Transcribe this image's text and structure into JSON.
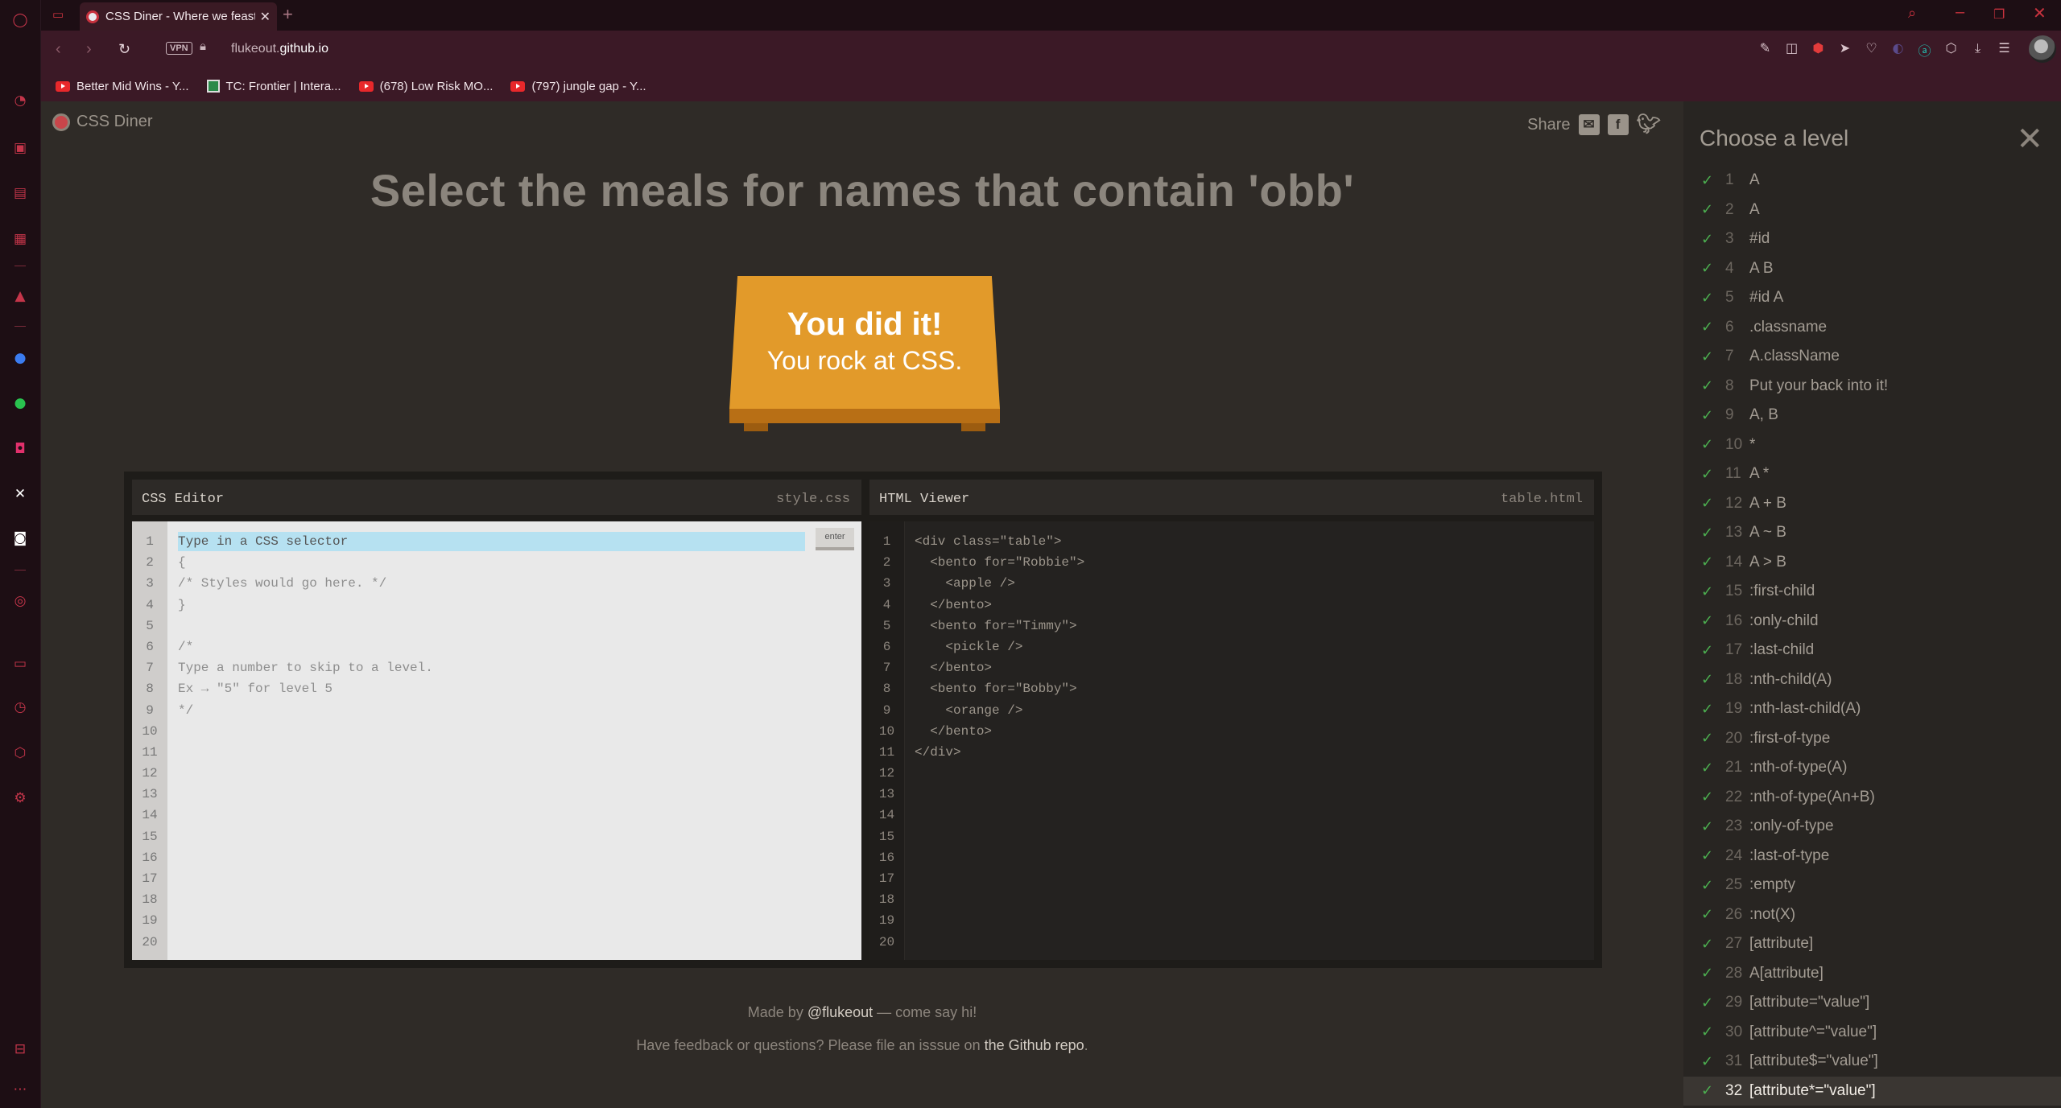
{
  "browser": {
    "tab_title": "CSS Diner - Where we feast on CSS",
    "url_host": "flukeout.",
    "url_domain": "github.io",
    "vpn_label": "VPN",
    "bookmarks": [
      {
        "label": "Better Mid Wins - Y...",
        "icon": "youtube-icon"
      },
      {
        "label": "TC: Frontier | Intera...",
        "icon": "tc-icon"
      },
      {
        "label": "(678) Low Risk MO...",
        "icon": "youtube-icon"
      },
      {
        "label": "(797) jungle gap - Y...",
        "icon": "youtube-icon"
      }
    ]
  },
  "page": {
    "brand": "CSS Diner",
    "share_label": "Share",
    "order": "Select the meals for names that contain 'obb'",
    "win_line1": "You did it!",
    "win_line2": "You rock at CSS.",
    "css_editor_title": "CSS Editor",
    "css_file": "style.css",
    "html_viewer_title": "HTML Viewer",
    "html_file": "table.html",
    "input_placeholder": "Type in a CSS selector",
    "enter_label": "enter",
    "css_lines": [
      "{",
      "/* Styles would go here. */",
      "}",
      "",
      "/*",
      "Type a number to skip to a level.",
      "Ex → \"5\" for level 5",
      "*/"
    ],
    "html_lines": [
      "<div class=\"table\">",
      "  <bento for=\"Robbie\">",
      "    <apple />",
      "  </bento>",
      "  <bento for=\"Timmy\">",
      "    <pickle />",
      "  </bento>",
      "  <bento for=\"Bobby\">",
      "    <orange />",
      "  </bento>",
      "</div>"
    ],
    "footer_made_by": "Made by ",
    "footer_handle": "@flukeout",
    "footer_say_hi": " — come say hi!",
    "footer_feedback": "Have feedback or questions? Please file an isssue on ",
    "footer_repo": "the Github repo",
    "footer_period": "."
  },
  "levels": {
    "title": "Choose a level",
    "current": 32,
    "items": [
      {
        "n": "1",
        "label": "A"
      },
      {
        "n": "2",
        "label": "A"
      },
      {
        "n": "3",
        "label": "#id"
      },
      {
        "n": "4",
        "label": "A B"
      },
      {
        "n": "5",
        "label": "#id A"
      },
      {
        "n": "6",
        "label": ".classname"
      },
      {
        "n": "7",
        "label": "A.className"
      },
      {
        "n": "8",
        "label": "Put your back into it!"
      },
      {
        "n": "9",
        "label": "A, B"
      },
      {
        "n": "10",
        "label": "*"
      },
      {
        "n": "11",
        "label": "A *"
      },
      {
        "n": "12",
        "label": "A + B"
      },
      {
        "n": "13",
        "label": "A ~ B"
      },
      {
        "n": "14",
        "label": "A > B"
      },
      {
        "n": "15",
        "label": ":first-child"
      },
      {
        "n": "16",
        "label": ":only-child"
      },
      {
        "n": "17",
        "label": ":last-child"
      },
      {
        "n": "18",
        "label": ":nth-child(A)"
      },
      {
        "n": "19",
        "label": ":nth-last-child(A)"
      },
      {
        "n": "20",
        "label": ":first-of-type"
      },
      {
        "n": "21",
        "label": ":nth-of-type(A)"
      },
      {
        "n": "22",
        "label": ":nth-of-type(An+B)"
      },
      {
        "n": "23",
        "label": ":only-of-type"
      },
      {
        "n": "24",
        "label": ":last-of-type"
      },
      {
        "n": "25",
        "label": ":empty"
      },
      {
        "n": "26",
        "label": ":not(X)"
      },
      {
        "n": "27",
        "label": "[attribute]"
      },
      {
        "n": "28",
        "label": "A[attribute]"
      },
      {
        "n": "29",
        "label": "[attribute=\"value\"]"
      },
      {
        "n": "30",
        "label": "[attribute^=\"value\"]"
      },
      {
        "n": "31",
        "label": "[attribute$=\"value\"]"
      },
      {
        "n": "32",
        "label": "[attribute*=\"value\"]"
      }
    ]
  }
}
